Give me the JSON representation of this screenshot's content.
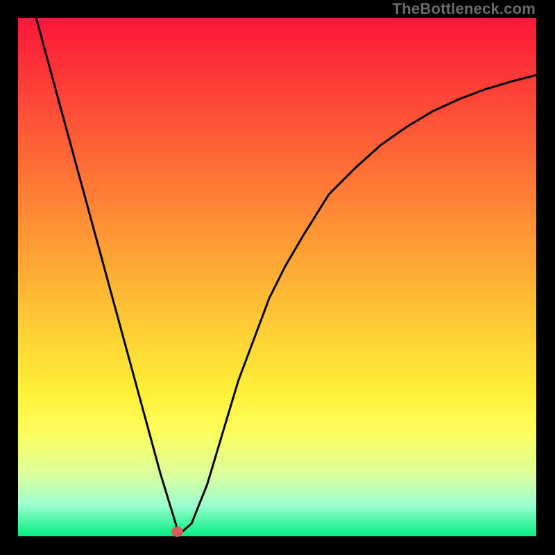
{
  "watermark": "TheBottleneck.com",
  "chart_data": {
    "type": "line",
    "title": "",
    "xlabel": "",
    "ylabel": "",
    "xlim": [
      0,
      100
    ],
    "ylim": [
      0,
      100
    ],
    "grid": false,
    "legend": false,
    "x": [
      3.5,
      6.5,
      9.5,
      12.5,
      15.5,
      18.5,
      21.5,
      24.5,
      27.5,
      30.5,
      30.7,
      31.6,
      33.5,
      36.5,
      39.5,
      42.5,
      45.5,
      48.5,
      51.5,
      55,
      60,
      65,
      70,
      75,
      80,
      85,
      90,
      95,
      100
    ],
    "values": [
      100,
      89,
      78,
      67,
      56,
      45,
      34,
      23,
      12,
      2.2,
      0.8,
      0.8,
      2.5,
      10,
      20,
      30,
      38,
      46,
      52,
      58,
      66,
      71,
      75.5,
      79,
      82,
      84.3,
      86.2,
      87.7,
      89
    ],
    "marker": {
      "x": 30.7,
      "y": 0.8,
      "color": "#d85c56"
    }
  },
  "colors": {
    "frame": "#000000",
    "gradient_top": "#fb1638",
    "gradient_bottom": "#00ee7e",
    "curve": "#000000",
    "marker": "#d85c56",
    "watermark": "#6a6a6a"
  }
}
